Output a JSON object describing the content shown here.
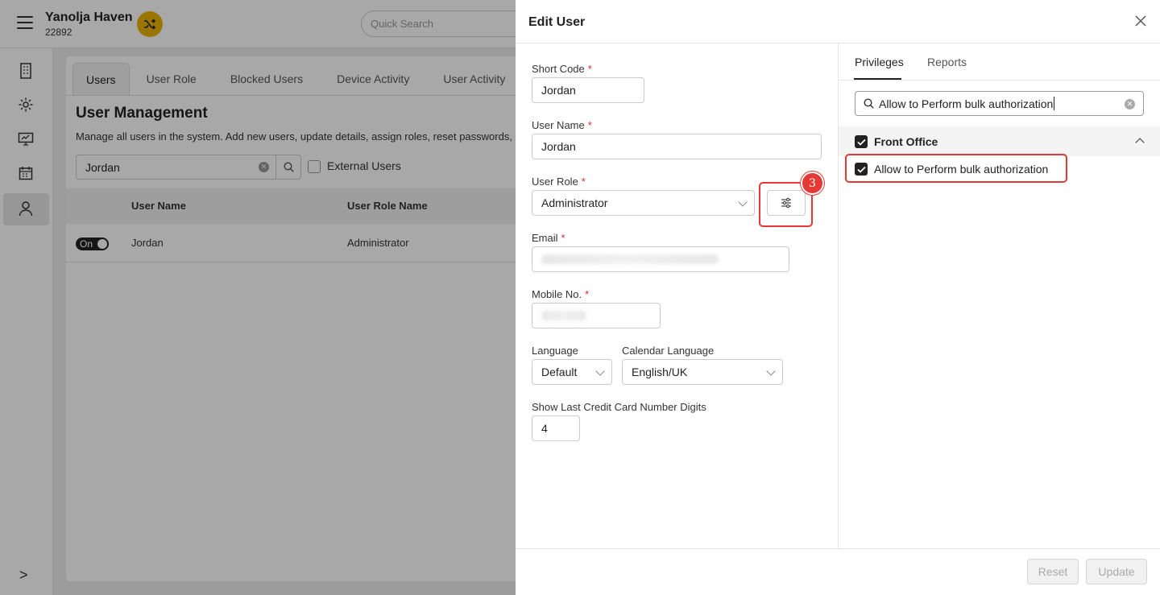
{
  "header": {
    "hotel_name": "Yanolja Haven",
    "hotel_id": "22892",
    "quick_search_placeholder": "Quick Search"
  },
  "background": {
    "tabs": [
      "Users",
      "User Role",
      "Blocked Users",
      "Device Activity",
      "User Activity"
    ],
    "title": "User Management",
    "description": "Manage all users in the system. Add new users, update details, assign roles, reset passwords, or",
    "search_value": "Jordan",
    "external_users_label": "External Users",
    "table": {
      "columns": [
        "User Name",
        "User Role Name"
      ],
      "rows": [
        {
          "status": "On",
          "user_name": "Jordan",
          "role": "Administrator"
        }
      ]
    }
  },
  "drawer": {
    "title": "Edit User",
    "fields": {
      "short_code_label": "Short Code",
      "short_code_value": "Jordan",
      "user_name_label": "User Name",
      "user_name_value": "Jordan",
      "user_role_label": "User Role",
      "user_role_value": "Administrator",
      "email_label": "Email",
      "mobile_label": "Mobile No.",
      "language_label": "Language",
      "language_value": "Default",
      "calendar_language_label": "Calendar Language",
      "calendar_language_value": "English/UK",
      "cc_digits_label": "Show Last Credit Card Number Digits",
      "cc_digits_value": "4",
      "required_marker": "*"
    },
    "step_badge": "3",
    "right_tabs": [
      "Privileges",
      "Reports"
    ],
    "privilege_search_value": "Allow to Perform bulk authorization",
    "group_label": "Front Office",
    "privilege_item_label": "Allow to Perform bulk authorization",
    "reset_label": "Reset",
    "update_label": "Update"
  },
  "colors": {
    "accent_highlight": "#e53935",
    "brand_badge": "#e8b400",
    "checkbox": "#222222"
  }
}
